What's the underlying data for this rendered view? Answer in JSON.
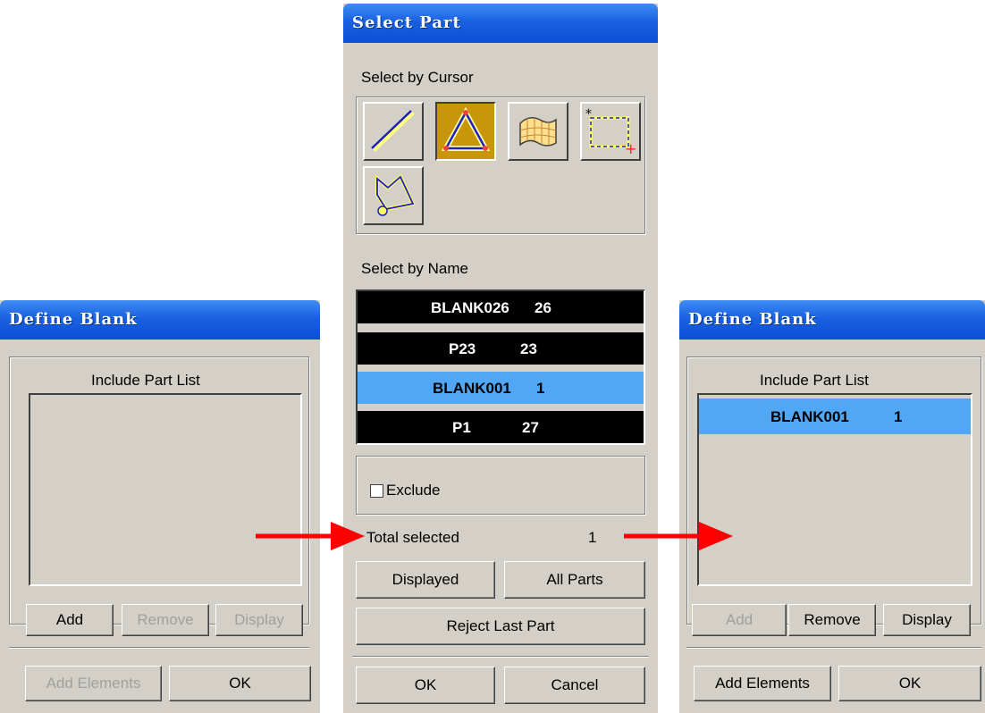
{
  "left_dialog": {
    "title": "Define Blank",
    "list_label": "Include Part List",
    "items": [],
    "add_label": "Add",
    "remove_label": "Remove",
    "display_label": "Display",
    "add_elements_label": "Add Elements",
    "ok_label": "OK"
  },
  "center_dialog": {
    "title": "Select Part",
    "select_by_cursor_label": "Select by Cursor",
    "cursor_tools": [
      "line-select-icon",
      "triangle-select-icon",
      "surface-select-icon",
      "box-select-icon",
      "polygon-select-icon"
    ],
    "select_by_name_label": "Select by Name",
    "parts": [
      {
        "name": "BLANK026",
        "id": "26",
        "selected": false
      },
      {
        "name": "P23",
        "id": "23",
        "selected": false
      },
      {
        "name": "BLANK001",
        "id": "1",
        "selected": true
      },
      {
        "name": "P1",
        "id": "27",
        "selected": false
      }
    ],
    "exclude_label": "Exclude",
    "exclude_checked": false,
    "total_selected_label": "Total selected",
    "total_selected_value": "1",
    "displayed_label": "Displayed",
    "all_parts_label": "All Parts",
    "reject_last_label": "Reject Last Part",
    "ok_label": "OK",
    "cancel_label": "Cancel"
  },
  "right_dialog": {
    "title": "Define Blank",
    "list_label": "Include Part List",
    "items": [
      {
        "name": "BLANK001",
        "id": "1",
        "selected": true
      }
    ],
    "add_label": "Add",
    "remove_label": "Remove",
    "display_label": "Display",
    "add_elements_label": "Add Elements",
    "ok_label": "OK"
  },
  "colors": {
    "selection": "#52a7f5",
    "arrow": "#ff0000",
    "title_bar": "#1a61e0"
  }
}
